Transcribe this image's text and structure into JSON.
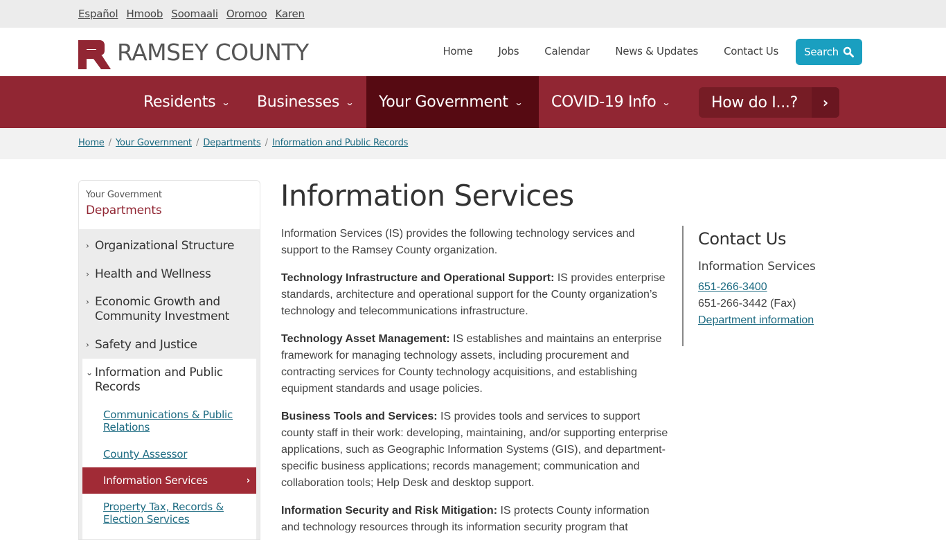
{
  "languages": [
    "Español",
    "Hmoob",
    "Soomaali",
    "Oromoo",
    "Karen"
  ],
  "brand": {
    "name": "RAMSEY COUNTY",
    "logo_color": "#912633"
  },
  "utility_nav": [
    "Home",
    "Jobs",
    "Calendar",
    "News & Updates",
    "Contact Us"
  ],
  "search": {
    "label": "Search",
    "icon": "search-icon",
    "color": "#1a9fc0"
  },
  "main_nav": {
    "items": [
      {
        "label": "Residents",
        "icon": "chevron-down-icon",
        "active": false
      },
      {
        "label": "Businesses",
        "icon": "chevron-down-icon",
        "active": false
      },
      {
        "label": "Your Government",
        "icon": "chevron-down-icon",
        "active": true
      },
      {
        "label": "COVID-19 Info",
        "icon": "chevron-down-icon",
        "active": false
      }
    ],
    "how_do_i": {
      "label": "How do I...?",
      "icon": "chevron-right-icon"
    },
    "color": "#912633",
    "active_color": "#560a12"
  },
  "breadcrumb": [
    "Home",
    "Your Government",
    "Departments",
    "Information and Public Records"
  ],
  "sidebar": {
    "parent": "Your Government",
    "title": "Departments",
    "items": [
      {
        "label": "Organizational Structure",
        "expanded": false
      },
      {
        "label": "Health and Wellness",
        "expanded": false
      },
      {
        "label": "Economic Growth and Community Investment",
        "expanded": false
      },
      {
        "label": "Safety and Justice",
        "expanded": false
      },
      {
        "label": "Information and Public Records",
        "expanded": true
      }
    ],
    "sub_items": [
      {
        "label": "Communications & Public Relations",
        "active": false
      },
      {
        "label": "County Assessor",
        "active": false
      },
      {
        "label": "Information Services",
        "active": true
      },
      {
        "label": "Property Tax, Records & Election Services",
        "active": false
      }
    ]
  },
  "page": {
    "title": "Information Services",
    "intro": "Information Services (IS) provides the following technology services and support to the Ramsey County organization.",
    "sections": [
      {
        "heading": "Technology Infrastructure and Operational Support:",
        "text": " IS provides enterprise standards, architecture and operational support for the County organization’s technology and telecommunications infrastructure."
      },
      {
        "heading": "Technology Asset Management:",
        "text": " IS establishes and maintains an enterprise framework for managing technology assets, including procurement and contracting services for County technology acquisitions, and establishing equipment standards and usage policies."
      },
      {
        "heading": "Business Tools and Services:",
        "text": " IS provides tools and services to support county staff in their work: developing, maintaining, and/or supporting enterprise applications, such as Geographic Information Systems (GIS), and department-specific business applications; records management; communication and collaboration tools; Help Desk and desktop support."
      },
      {
        "heading": "Information Security and Risk Mitigation:",
        "text": " IS protects County information and technology resources through its information security program that"
      }
    ]
  },
  "contact": {
    "title": "Contact Us",
    "department": "Information Services",
    "phone": "651-266-3400",
    "fax": "651-266-3442 (Fax)",
    "link": "Department information"
  }
}
